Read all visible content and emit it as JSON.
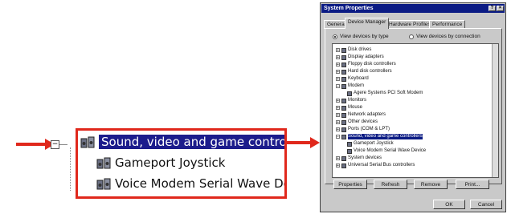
{
  "callout": {
    "rows": [
      {
        "label": "Sound, video and game controllers",
        "selected": true
      },
      {
        "label": "Gameport Joystick",
        "selected": false
      },
      {
        "label": "Voice Modem Serial Wave Dev",
        "selected": false
      }
    ],
    "expand_glyph": "−"
  },
  "window": {
    "title": "System Properties",
    "title_buttons": [
      "?",
      "×"
    ],
    "tabs": [
      "General",
      "Device Manager",
      "Hardware Profiles",
      "Performance"
    ],
    "active_tab": "Device Manager",
    "radio_type": "View devices by type",
    "radio_connection": "View devices by connection",
    "devices": [
      {
        "label": "Disk drives",
        "sign": "+"
      },
      {
        "label": "Display adapters",
        "sign": "+"
      },
      {
        "label": "Floppy disk controllers",
        "sign": "+"
      },
      {
        "label": "Hard disk controllers",
        "sign": "+"
      },
      {
        "label": "Keyboard",
        "sign": "+"
      },
      {
        "label": "Modem",
        "sign": "−"
      },
      {
        "label": "Agere Systems PCI Soft Modem",
        "sign": ""
      },
      {
        "label": "Monitors",
        "sign": "+"
      },
      {
        "label": "Mouse",
        "sign": "+"
      },
      {
        "label": "Network adapters",
        "sign": "+"
      },
      {
        "label": "Other devices",
        "sign": "+"
      },
      {
        "label": "Ports (COM & LPT)",
        "sign": "+"
      },
      {
        "label": "Sound, video and game controllers",
        "sign": "−"
      },
      {
        "label": "Gameport Joystick",
        "sign": ""
      },
      {
        "label": "Voice Modem Serial Wave Device",
        "sign": ""
      },
      {
        "label": "System devices",
        "sign": "+"
      },
      {
        "label": "Universal Serial Bus controllers",
        "sign": "+"
      }
    ],
    "buttons": [
      "Properties",
      "Refresh",
      "Remove",
      "Print..."
    ],
    "footer_buttons": [
      "OK",
      "Cancel"
    ]
  }
}
